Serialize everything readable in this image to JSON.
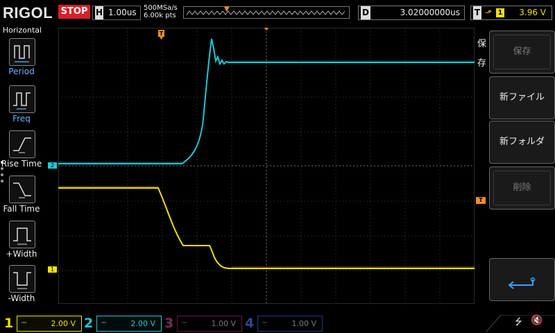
{
  "top": {
    "brand": "RIGOL",
    "run_state": "STOP",
    "timebase_label": "H",
    "timebase_value": "1.00us",
    "sample_rate": "500MSa/s",
    "memory_depth": "6.00k pts",
    "delay_label": "D",
    "delay_value": "3.02000000us",
    "trigger_label": "T",
    "trigger_edge": "⬏",
    "trigger_channel": "1",
    "trigger_level": "3.96 V"
  },
  "left_menu": {
    "title": "Horizontal",
    "items": [
      {
        "label": "Period",
        "icon": "period-icon"
      },
      {
        "label": "Freq",
        "icon": "frequency-icon"
      },
      {
        "label": "Rise Time",
        "icon": "rise-time-icon"
      },
      {
        "label": "Fall Time",
        "icon": "fall-time-icon"
      },
      {
        "label": "+Width",
        "icon": "positive-width-icon"
      },
      {
        "label": "-Width",
        "icon": "negative-width-icon"
      }
    ]
  },
  "right_menu": {
    "title": "保存",
    "buttons": [
      {
        "label": "保存",
        "enabled": false
      },
      {
        "label": "新ファイル",
        "enabled": true
      },
      {
        "label": "新フォルダ",
        "enabled": true
      },
      {
        "label": "削除",
        "enabled": false
      }
    ],
    "back_icon": "return-arrow-icon"
  },
  "markers": {
    "ch2": "2",
    "ch1": "1",
    "trigger_top": "T",
    "trigger_level": "T"
  },
  "channels": [
    {
      "num": "1",
      "scale": "2.00 V",
      "color": "#f0e000",
      "active": true
    },
    {
      "num": "2",
      "scale": "2.00 V",
      "color": "#1fc8d8",
      "active": true
    },
    {
      "num": "3",
      "scale": "1.00 V",
      "color": "#c0208c",
      "active": false
    },
    {
      "num": "4",
      "scale": "1.00 V",
      "color": "#2a5cd8",
      "active": false
    }
  ],
  "colors": {
    "ch1": "#f0e000",
    "ch2": "#1fc8d8",
    "stop": "#d4202a",
    "trigger": "#f08c22",
    "menu_accent": "#5fb8ff"
  }
}
